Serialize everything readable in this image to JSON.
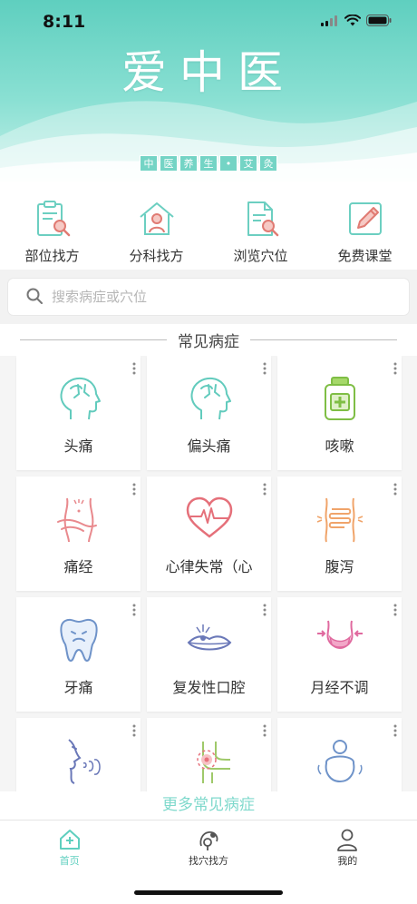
{
  "status_bar": {
    "time": "8:11"
  },
  "app": {
    "title": "爱中医",
    "subtitle_chars": [
      "中",
      "医",
      "养",
      "生",
      "•",
      "艾",
      "灸"
    ]
  },
  "quick_nav": [
    {
      "label": "部位找方",
      "icon": "clipboard-search-icon"
    },
    {
      "label": "分科找方",
      "icon": "house-doctor-icon"
    },
    {
      "label": "浏览穴位",
      "icon": "document-search-icon"
    },
    {
      "label": "免费课堂",
      "icon": "pencil-edit-icon"
    }
  ],
  "search": {
    "placeholder": "搜索病症或穴位"
  },
  "section": {
    "title": "常见病症"
  },
  "conditions": [
    {
      "label": "头痛",
      "icon": "head-pain-icon"
    },
    {
      "label": "偏头痛",
      "icon": "head-pain-icon"
    },
    {
      "label": "咳嗽",
      "icon": "medicine-bottle-icon"
    },
    {
      "label": "痛经",
      "icon": "abdomen-pain-icon"
    },
    {
      "label": "心律失常（心",
      "icon": "heart-rate-icon"
    },
    {
      "label": "腹泻",
      "icon": "intestine-icon"
    },
    {
      "label": "牙痛",
      "icon": "tooth-icon"
    },
    {
      "label": "复发性口腔",
      "icon": "mouth-icon"
    },
    {
      "label": "月经不调",
      "icon": "waist-icon"
    },
    {
      "label": "",
      "icon": "face-cough-icon"
    },
    {
      "label": "",
      "icon": "knee-pain-icon"
    },
    {
      "label": "",
      "icon": "obesity-icon"
    }
  ],
  "more_link": "更多常见病症",
  "tabbar": [
    {
      "label": "首页",
      "icon": "home-icon",
      "active": true
    },
    {
      "label": "找穴找方",
      "icon": "acupoint-icon",
      "active": false
    },
    {
      "label": "我的",
      "icon": "person-icon",
      "active": false
    }
  ],
  "colors": {
    "accent": "#5fcfbf",
    "light_accent": "#7fd9cc"
  }
}
